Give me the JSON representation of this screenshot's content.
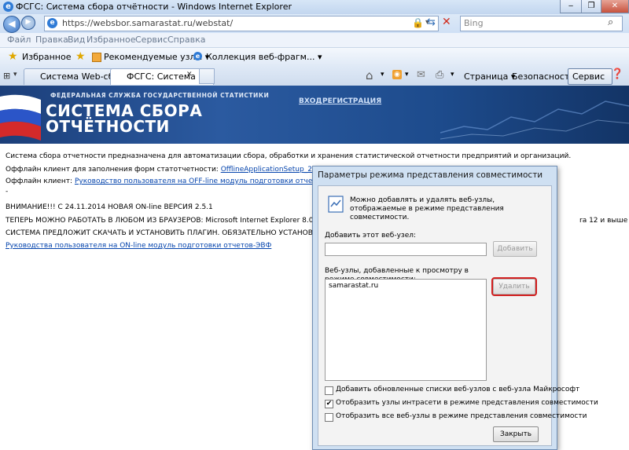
{
  "window": {
    "title": "ФСГС: Система сбора отчётности - Windows Internet Explorer",
    "min": "‒",
    "max": "❐",
    "close": "✕"
  },
  "address": {
    "url": "https://websbor.samarastat.ru/webstat/"
  },
  "search": {
    "placeholder": "Bing"
  },
  "menubar": [
    "Файл",
    "Правка",
    "Вид",
    "Избранное",
    "Сервис",
    "Справка"
  ],
  "favbar": {
    "favorites": "Избранное",
    "suggested": "Рекомендуемые узлы ▾",
    "gallery": "Коллекция веб-фрагм... ▾"
  },
  "tabs": [
    "Система Web-сбор...",
    "ФСГС: Система с..."
  ],
  "commands": {
    "page": "Страница ▾",
    "security": "Безопасность ▾",
    "service": "Сервис ▾"
  },
  "banner": {
    "org": "ФЕДЕРАЛЬНАЯ СЛУЖБА ГОСУДАРСТВЕННОЙ СТАТИСТИКИ",
    "title1": "СИСТЕМА СБОРА",
    "title2": "ОТЧЁТНОСТИ",
    "login": "ВХОД",
    "register": "РЕГИСТРАЦИЯ"
  },
  "content": {
    "intro": "Система сбора отчетности предназначена для автоматизации сбора, обработки и хранения статистической отчетности предприятий и организаций.",
    "offline_label": "Оффлайн клиент для заполнения форм статотчетности:",
    "offline_link": "OfflineApplicationSetup_2_5_1.zip",
    "offline_manual_label": "Оффлайн клиент:",
    "offline_manual_link": "Руководство пользователя на OFF-line модуль подготовки отчетов-ЭВФ",
    "dot": "-",
    "notice": "ВНИМАНИЕ!!! С 24.11.2014 НОВАЯ ON-line ВЕРСИЯ 2.5.1",
    "browsers": "ТЕПЕРЬ МОЖНО РАБОТАТЬ В ЛЮБОМ ИЗ БРАУЗЕРОВ: Microsoft Internet Explorer 8.0 и выше; Goo",
    "browsers_tail": "ra 12 и выше",
    "plugin": "СИСТЕМА ПРЕДЛОЖИТ СКАЧАТЬ И УСТАНОВИТЬ ПЛАГИН. ОБЯЗАТЕЛЬНО УСТАНОВИТЕ",
    "online_manual": "Руководства пользователя на ON-line модуль подготовки отчетов-ЭВФ"
  },
  "dialog": {
    "title": "Параметры режима представления совместимости",
    "description": "Можно добавлять и удалять веб-узлы, отображаемые в режиме представления совместимости.",
    "add_label": "Добавить этот веб-узел:",
    "add_value": "",
    "add_button": "Добавить",
    "list_label": "Веб-узлы, добавленные к просмотру в режиме совместимости:",
    "sites": [
      "samarastat.ru"
    ],
    "remove_button": "Удалить",
    "options": [
      {
        "label": "Добавить обновленные списки веб-узлов с веб-узла Майкрософт",
        "checked": false
      },
      {
        "label": "Отобразить узлы интрасети в режиме представления совместимости",
        "checked": true
      },
      {
        "label": "Отобразить все веб-узлы в режиме представления совместимости",
        "checked": false
      }
    ],
    "close_button": "Закрыть"
  }
}
